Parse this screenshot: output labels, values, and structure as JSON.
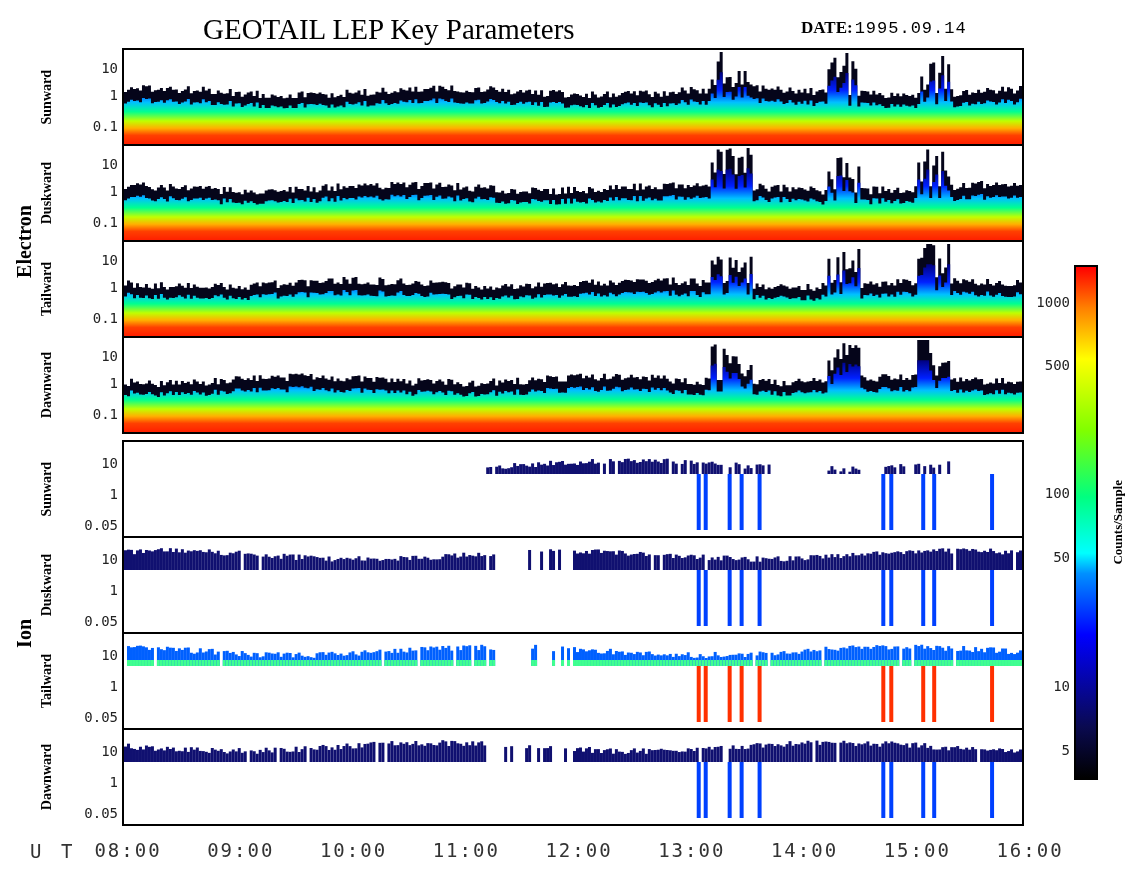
{
  "title": "GEOTAIL LEP Key Parameters",
  "date": {
    "label": "DATE:",
    "value": "1995.09.14"
  },
  "groups": [
    {
      "name": "Electron",
      "kind": "electron",
      "panels": [
        {
          "label": "Sunward",
          "y_ticks": [
            "10",
            "1",
            "0.1"
          ]
        },
        {
          "label": "Duskward",
          "y_ticks": [
            "10",
            "1",
            "0.1"
          ]
        },
        {
          "label": "Tailward",
          "y_ticks": [
            "10",
            "1",
            "0.1"
          ]
        },
        {
          "label": "Dawnward",
          "y_ticks": [
            "10",
            "1",
            "0.1"
          ]
        }
      ]
    },
    {
      "name": "Ion",
      "kind": "ion",
      "panels": [
        {
          "label": "Sunward",
          "y_ticks": [
            "10",
            "1",
            "0.05"
          ]
        },
        {
          "label": "Duskward",
          "y_ticks": [
            "10",
            "1",
            "0.05"
          ]
        },
        {
          "label": "Tailward",
          "y_ticks": [
            "10",
            "1",
            "0.05"
          ]
        },
        {
          "label": "Dawnward",
          "y_ticks": [
            "10",
            "1",
            "0.05"
          ]
        }
      ]
    }
  ],
  "x_axis": {
    "label": "U T",
    "ticks": [
      "08:00",
      "09:00",
      "10:00",
      "11:00",
      "12:00",
      "13:00",
      "14:00",
      "15:00",
      "16:00"
    ]
  },
  "colorbar": {
    "label": "Counts/Sample",
    "ticks": [
      "1000",
      "500",
      "100",
      "50",
      "10",
      "5"
    ]
  }
}
